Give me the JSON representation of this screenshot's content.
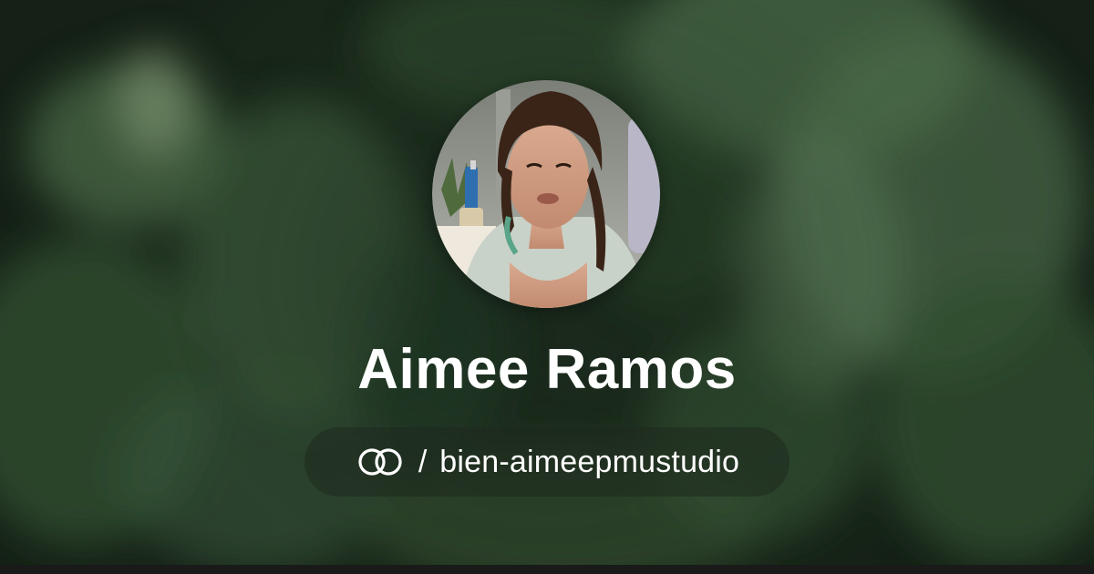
{
  "profile": {
    "name": "Aimee Ramos",
    "separator": "/",
    "handle": "bien-aimeepmustudio",
    "logo_icon": "interlocking-rings-icon",
    "avatar_alt": "profile-photo"
  },
  "colors": {
    "text": "#ffffff",
    "background": "#1c2c1d",
    "pill": "rgba(30,40,30,0.55)"
  }
}
